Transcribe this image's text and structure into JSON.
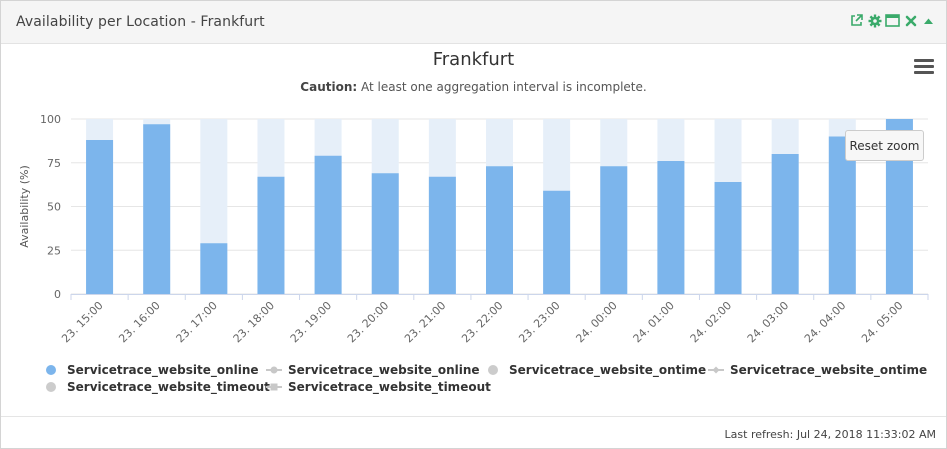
{
  "panel": {
    "title": "Availability per Location - Frankfurt"
  },
  "header_icons": [
    "external-link-icon",
    "gear-icon",
    "maximize-icon",
    "close-icon",
    "collapse-up-icon"
  ],
  "chart": {
    "caution_label": "Caution:",
    "caution_text": " At least one aggregation interval is incomplete.",
    "reset_zoom_label": "Reset zoom"
  },
  "legend": [
    {
      "label": "Servicetrace_website_online",
      "symbol": "circle",
      "color": "#7cb5ec"
    },
    {
      "label": "Servicetrace_website_online",
      "symbol": "line-circle",
      "color": "#c8c8c8"
    },
    {
      "label": "Servicetrace_website_ontime",
      "symbol": "circle",
      "color": "#cccccc"
    },
    {
      "label": "Servicetrace_website_ontime",
      "symbol": "line-diamond",
      "color": "#c8c8c8"
    },
    {
      "label": "Servicetrace_website_timeout",
      "symbol": "circle",
      "color": "#cccccc"
    },
    {
      "label": "Servicetrace_website_timeout",
      "symbol": "line-square",
      "color": "#c8c8c8"
    }
  ],
  "footer": {
    "last_refresh": "Last refresh: Jul 24, 2018 11:33:02 AM"
  },
  "chart_data": {
    "type": "bar",
    "title": "Frankfurt",
    "xlabel": "",
    "ylabel": "Availability (%)",
    "ylim": [
      0,
      100
    ],
    "yticks": [
      0,
      25,
      50,
      75,
      100
    ],
    "grid": true,
    "categories": [
      "23. 15:00",
      "23. 16:00",
      "23. 17:00",
      "23. 18:00",
      "23. 19:00",
      "23. 20:00",
      "23. 21:00",
      "23. 22:00",
      "23. 23:00",
      "24. 00:00",
      "24. 01:00",
      "24. 02:00",
      "24. 03:00",
      "24. 04:00",
      "24. 05:00"
    ],
    "series": [
      {
        "name": "Servicetrace_website_online",
        "color": "#7cb5ec",
        "values": [
          88,
          97,
          29,
          67,
          79,
          69,
          67,
          73,
          59,
          73,
          76,
          64,
          80,
          90,
          100
        ]
      }
    ],
    "background_value": 100,
    "background_color": "#e6eff9"
  }
}
